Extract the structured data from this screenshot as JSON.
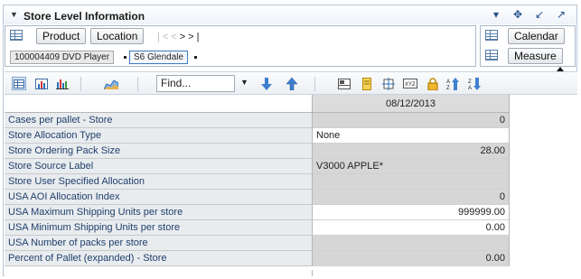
{
  "window": {
    "title": "Store Level Information"
  },
  "pivot": {
    "row_dims": [
      "Product",
      "Location"
    ],
    "tiles": [
      "100004409 DVD Player",
      "S6 Glendale"
    ],
    "col_dims": [
      "Calendar",
      "Measure"
    ],
    "nav": {
      "first": "|<",
      "prev": "<",
      "next": ">",
      "last": ">|"
    }
  },
  "toolbar": {
    "find_placeholder": "Find..."
  },
  "table": {
    "column_header": "08/12/2013",
    "rows": [
      {
        "label": "Cases per pallet - Store",
        "value": "0"
      },
      {
        "label": "Store Allocation Type",
        "value": "None"
      },
      {
        "label": "Store Ordering Pack Size",
        "value": "28.00"
      },
      {
        "label": "Store Source Label",
        "value": "V3000 APPLE*"
      },
      {
        "label": "Store User Specified Allocation",
        "value": ""
      },
      {
        "label": "USA AOI Allocation Index",
        "value": "0"
      },
      {
        "label": "USA Maximum Shipping Units per store",
        "value": "999999.00"
      },
      {
        "label": "USA Minimum Shipping Units per store",
        "value": "0.00"
      },
      {
        "label": "USA Number of packs per store",
        "value": ""
      },
      {
        "label": "Percent of Pallet (expanded) - Store",
        "value": "0.00"
      }
    ]
  },
  "colors": {
    "readonly_cell": "#d6d6d6",
    "row_label_bg": "#e9ecef",
    "accent": "#21508f"
  }
}
